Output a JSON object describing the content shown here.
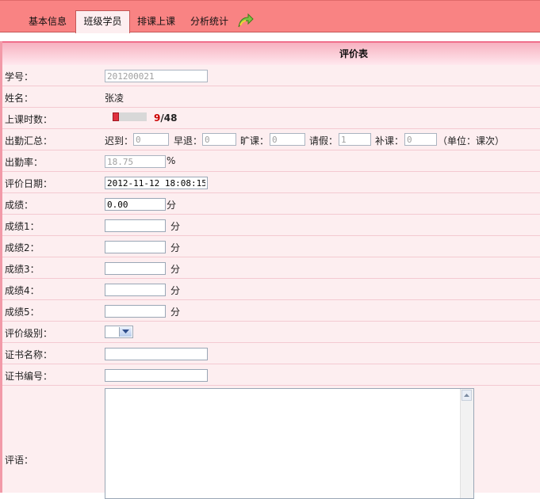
{
  "tabs": [
    {
      "label": "基本信息"
    },
    {
      "label": "班级学员"
    },
    {
      "label": "排课上课"
    },
    {
      "label": "分析统计"
    }
  ],
  "panel": {
    "title": "评价表"
  },
  "form": {
    "student_no": {
      "label": "学号：",
      "value": "201200021"
    },
    "name": {
      "label": "姓名：",
      "value": "张凌"
    },
    "hours": {
      "label": "上课时数：",
      "current": "9",
      "total": "/48",
      "progress": 0.1875
    },
    "attendance": {
      "label": "出勤汇总：",
      "late": {
        "label": "迟到：",
        "value": "0"
      },
      "early": {
        "label": "早退：",
        "value": "0"
      },
      "absent": {
        "label": "旷课：",
        "value": "0"
      },
      "leave": {
        "label": "请假：",
        "value": "1"
      },
      "makeup": {
        "label": "补课：",
        "value": "0"
      },
      "unit": "（单位：课次）"
    },
    "attendance_rate": {
      "label": "出勤率：",
      "value": "18.75",
      "unit": "%"
    },
    "eval_date": {
      "label": "评价日期：",
      "value": "2012-11-12 18:08:15"
    },
    "score": {
      "label": "成绩：",
      "value": "0.00",
      "unit": "分"
    },
    "score1": {
      "label": "成绩1：",
      "value": "",
      "unit": "分"
    },
    "score2": {
      "label": "成绩2：",
      "value": "",
      "unit": "分"
    },
    "score3": {
      "label": "成绩3：",
      "value": "",
      "unit": "分"
    },
    "score4": {
      "label": "成绩4：",
      "value": "",
      "unit": "分"
    },
    "score5": {
      "label": "成绩5：",
      "value": "",
      "unit": "分"
    },
    "eval_level": {
      "label": "评价级别：",
      "value": ""
    },
    "cert_name": {
      "label": "证书名称：",
      "value": ""
    },
    "cert_no": {
      "label": "证书编号：",
      "value": ""
    },
    "comment": {
      "label": "评语：",
      "value": ""
    }
  }
}
